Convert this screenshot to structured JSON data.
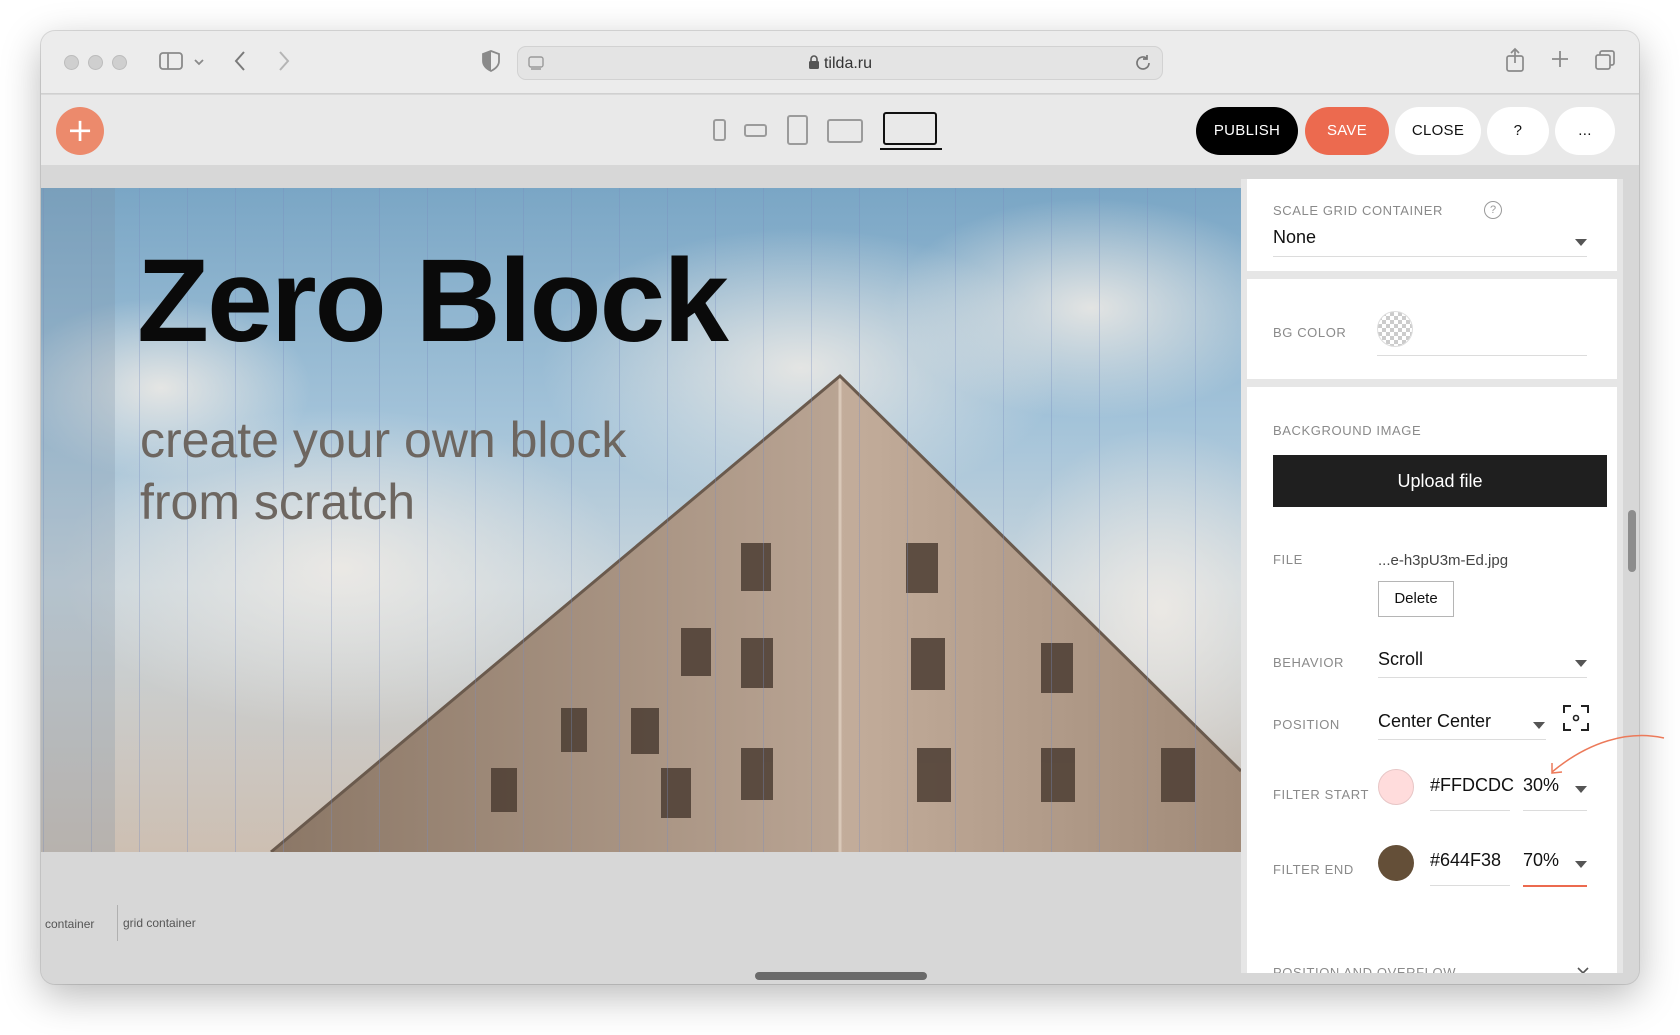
{
  "browser": {
    "url": "tilda.ru",
    "icons": [
      "sidebar-icon",
      "chevron-down-icon",
      "back-icon",
      "forward-icon",
      "shield-icon",
      "lock-icon",
      "reload-icon",
      "share-icon",
      "plus-icon",
      "tabs-icon"
    ]
  },
  "toolbar": {
    "add_label": "+",
    "devices": [
      "phone-portrait-icon",
      "phone-landscape-icon",
      "tablet-portrait-icon",
      "tablet-landscape-icon",
      "laptop-icon"
    ],
    "publish_label": "PUBLISH",
    "save_label": "SAVE",
    "close_label": "CLOSE",
    "help_label": "?",
    "more_label": "...",
    "colors": {
      "save": "#ec6a4f",
      "add": "#ec8a6c",
      "publish": "#000000"
    }
  },
  "canvas": {
    "title": "Zero Block",
    "subtitle": "create your own block from scratch",
    "captions": [
      "container",
      "grid container"
    ]
  },
  "panel": {
    "scale_grid": {
      "label": "SCALE GRID CONTAINER",
      "value": "None"
    },
    "bg_color": {
      "label": "BG COLOR"
    },
    "background_image": {
      "label": "BACKGROUND IMAGE",
      "upload_label": "Upload file",
      "file_label": "FILE",
      "file_name": "...e-h3pU3m-Ed.jpg",
      "delete_label": "Delete",
      "behavior_label": "BEHAVIOR",
      "behavior_value": "Scroll",
      "position_label": "POSITION",
      "position_value": "Center Center",
      "filter_start_label": "FILTER START",
      "filter_start_color": "#FFDCDC",
      "filter_start_opacity": "30%",
      "filter_end_label": "FILTER END",
      "filter_end_color": "#644F38",
      "filter_end_opacity": "70%"
    },
    "position_overflow": {
      "label": "POSITION AND OVERFLOW"
    }
  }
}
